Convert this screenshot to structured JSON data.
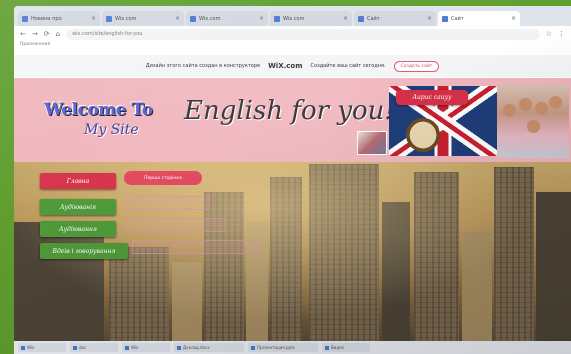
{
  "browser": {
    "tabs": [
      {
        "label": "Новини про"
      },
      {
        "label": "Wix.com"
      },
      {
        "label": "Wix.com"
      },
      {
        "label": "Wix.com"
      },
      {
        "label": "Сайт"
      },
      {
        "label": "Сайт"
      }
    ],
    "url": "wix.com/site/english-for-you",
    "bookmarks_label": "Приложения"
  },
  "wix_banner": {
    "text": "Дизайн этого сайта создан в конструкторе",
    "brand": "WiX.com",
    "text2": "Создайте ваш сайт сегодня.",
    "button": "Создать сайт"
  },
  "header": {
    "logo_line1": "Welcome To",
    "logo_line2": "My Site",
    "tagline": "English for you!",
    "pill": "Aupuc cauyy"
  },
  "hero": {
    "pill": "Перша сторінка",
    "menu": [
      {
        "label": "Главна"
      },
      {
        "label": "Аудіюванія"
      },
      {
        "label": "Аудіювання"
      },
      {
        "label": "Вдеів і говорування"
      }
    ]
  },
  "taskbar": {
    "items": [
      {
        "label": "Wix"
      },
      {
        "label": "doc"
      },
      {
        "label": "Wix"
      },
      {
        "label": "Доклад.docx"
      },
      {
        "label": "Презентация.pptx"
      },
      {
        "label": "Видео"
      }
    ]
  },
  "colors": {
    "header_pink": "#f0b6bd",
    "menu_red": "#d8344c",
    "menu_green": "#4f9a3a",
    "background_green": "#5f9e2f"
  }
}
